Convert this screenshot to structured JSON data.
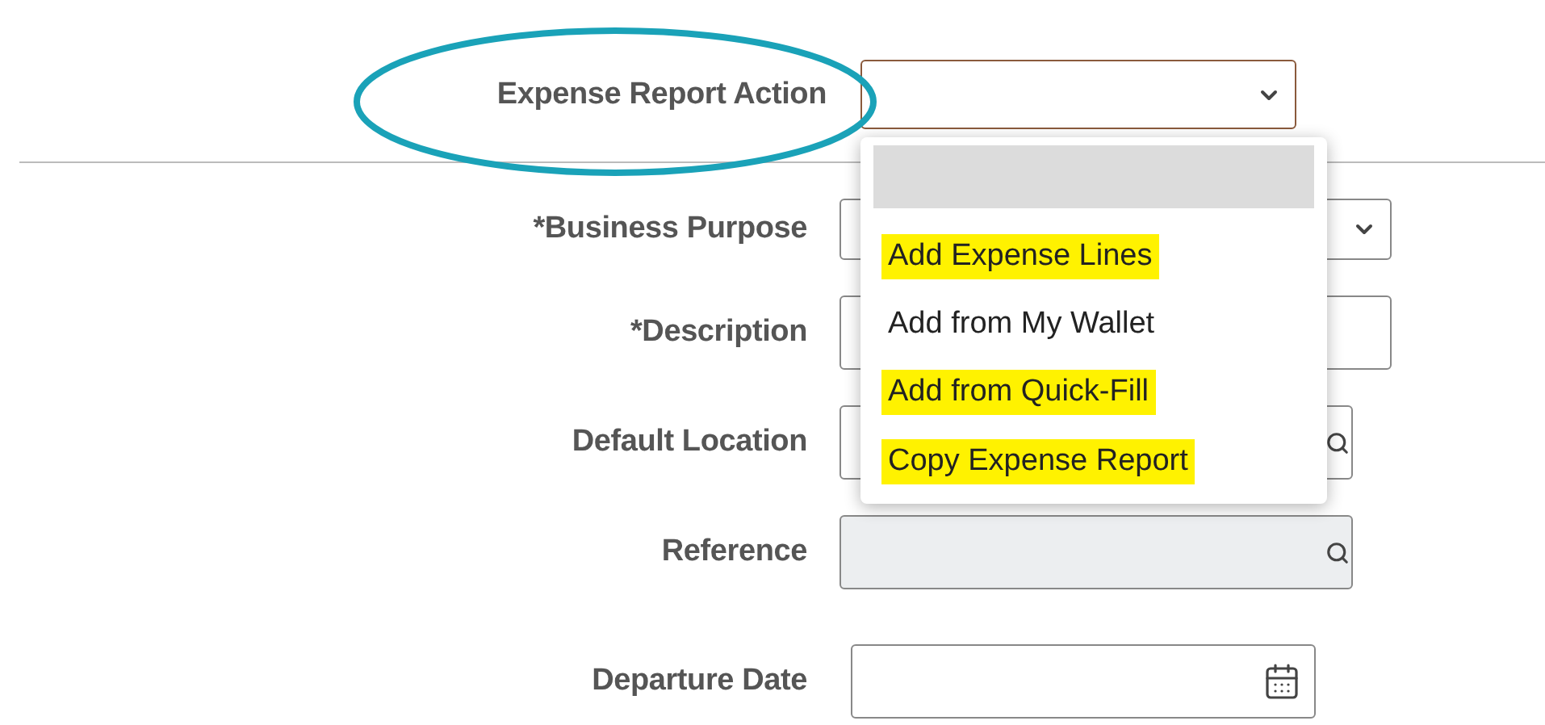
{
  "header": {
    "label": "Expense Report Action",
    "circled": true,
    "field": {
      "kind": "select"
    }
  },
  "dropdown": {
    "open": true,
    "blank_option_selected": true,
    "options": [
      {
        "label": "Add Expense Lines",
        "highlighted": true
      },
      {
        "label": "Add from My Wallet",
        "highlighted": false
      },
      {
        "label": "Add from Quick-Fill",
        "highlighted": true
      },
      {
        "label": "Copy Expense Report",
        "highlighted": true
      }
    ]
  },
  "fields": [
    {
      "label": "*Business Purpose",
      "kind": "select"
    },
    {
      "label": "*Description",
      "kind": "text"
    },
    {
      "label": "Default Location",
      "kind": "lookup"
    },
    {
      "label": "Reference",
      "kind": "lookup",
      "disabled": true
    },
    {
      "label": "Departure Date",
      "kind": "date"
    }
  ]
}
